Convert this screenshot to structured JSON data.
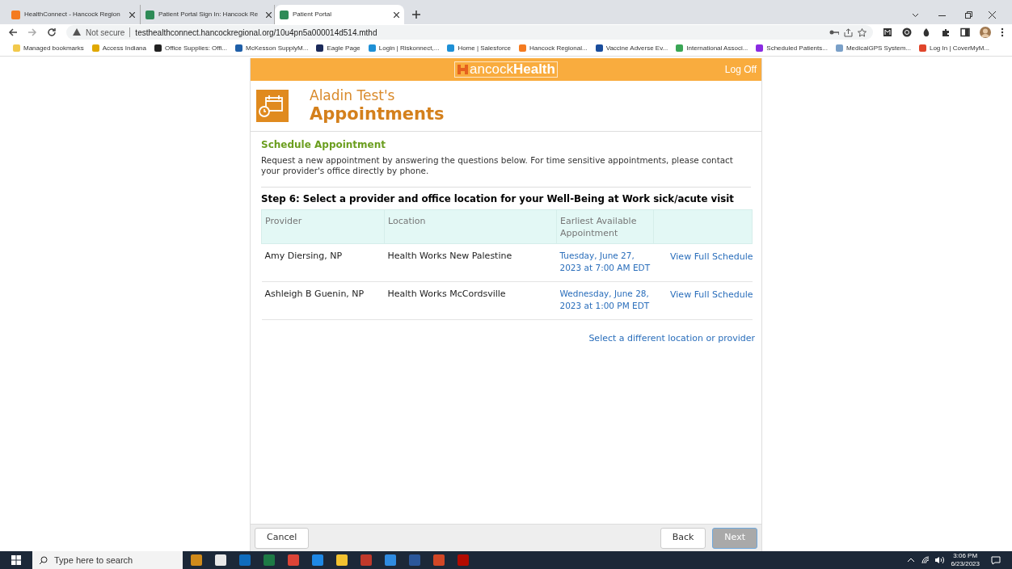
{
  "browser": {
    "tabs": [
      {
        "title": "HealthConnect - Hancock Region",
        "selected": false,
        "color": "#f47b20"
      },
      {
        "title": "Patient Portal Sign In: Hancock Re",
        "selected": false,
        "color": "#2e8b57"
      },
      {
        "title": "Patient Portal",
        "selected": true,
        "color": "#2e8b57"
      }
    ],
    "security": "Not secure",
    "url": "testhealthconnect.hancockregional.org/10u4pn5a000014d514.mthd",
    "bookmarks": [
      {
        "label": "Managed bookmarks",
        "color": "#f2c94c"
      },
      {
        "label": "Access Indiana",
        "color": "#e0a800"
      },
      {
        "label": "Office Supplies: Offi...",
        "color": "#222222"
      },
      {
        "label": "McKesson SupplyM...",
        "color": "#1f5fa8"
      },
      {
        "label": "Eagle Page",
        "color": "#1b2a5a"
      },
      {
        "label": "Login | Riskonnect,...",
        "color": "#1e90d6"
      },
      {
        "label": "Home | Salesforce",
        "color": "#1e90d6"
      },
      {
        "label": "Hancock Regional...",
        "color": "#f47b20"
      },
      {
        "label": "Vaccine Adverse Ev...",
        "color": "#1a4d9c"
      },
      {
        "label": "International Associ...",
        "color": "#3aa655"
      },
      {
        "label": "Scheduled Patients...",
        "color": "#8a2be2"
      },
      {
        "label": "MedicalGPS System...",
        "color": "#7aa0c8"
      },
      {
        "label": "Log In | CoverMyM...",
        "color": "#e0452b"
      }
    ]
  },
  "portal": {
    "logo": "ancock**Health**",
    "log_off": "Log Off",
    "owner": "Aladin Test's",
    "title": "Appointments",
    "section_title": "Schedule Appointment",
    "intro": "Request a new appointment by answering the questions below. For time sensitive appointments, please contact your provider's office directly by phone.",
    "step_title": "Step 6: Select a provider and office location for your Well-Being at Work sick/acute visit",
    "table": {
      "columns": [
        "Provider",
        "Location",
        "Earliest Available Appointment"
      ],
      "rows": [
        {
          "provider": "Amy Diersing, NP",
          "location": "Health Works New Palestine",
          "appointment": "Tuesday, June 27, 2023 at 7:00 AM EDT",
          "action": "View Full Schedule"
        },
        {
          "provider": "Ashleigh B Guenin, NP",
          "location": "Health Works McCordsville",
          "appointment": "Wednesday, June 28, 2023 at 1:00 PM EDT",
          "action": "View Full Schedule"
        }
      ]
    },
    "other_link": "Select a different location or provider",
    "buttons": [
      {
        "label": "Cancel",
        "disabled": false
      },
      {
        "label": "Back",
        "disabled": false
      },
      {
        "label": "Next",
        "disabled": true
      }
    ]
  },
  "taskbar": {
    "search_placeholder": "Type here to search",
    "time": "3:06 PM",
    "date": "6/23/2023",
    "apps": [
      {
        "color": "#d08a1a"
      },
      {
        "color": "#e8e8e8"
      },
      {
        "color": "#0f6cbd"
      },
      {
        "color": "#1d7a45"
      },
      {
        "color": "#db4437"
      },
      {
        "color": "#1e88e5"
      },
      {
        "color": "#f2c230"
      },
      {
        "color": "#c0392b"
      },
      {
        "color": "#2f8be0"
      },
      {
        "color": "#2b579a"
      },
      {
        "color": "#d24726"
      },
      {
        "color": "#b30b00"
      }
    ]
  }
}
